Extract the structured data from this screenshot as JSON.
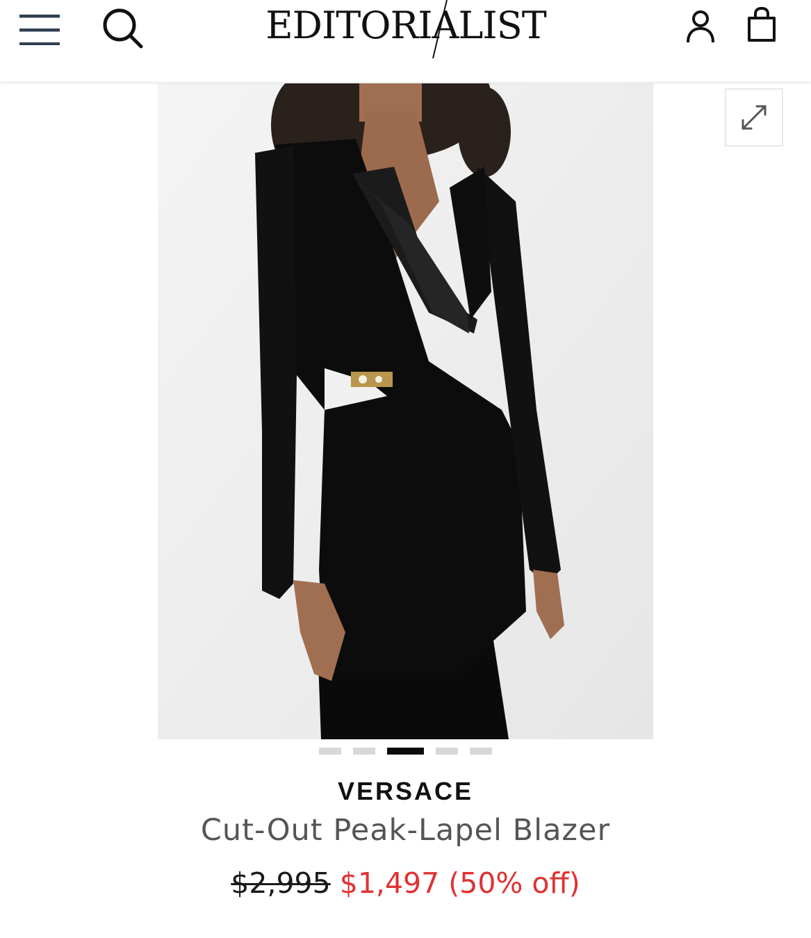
{
  "header": {
    "logo_text": "EDITORIALIST",
    "menu_icon": "hamburger-menu-icon",
    "search_icon": "search-icon",
    "account_icon": "user-icon",
    "bag_icon": "shopping-bag-icon"
  },
  "gallery": {
    "expand_icon": "expand-arrows-icon",
    "image_count": 5,
    "active_index": 2
  },
  "product": {
    "brand": "VERSACE",
    "name": "Cut-Out Peak-Lapel Blazer",
    "original_price": "$2,995",
    "sale_price": "$1,497",
    "discount": "(50% off)"
  },
  "colors": {
    "sale": "#e03131",
    "text": "#111111",
    "muted": "#555555",
    "dot_inactive": "#d8d8d8",
    "dot_active": "#0b0b0b"
  }
}
